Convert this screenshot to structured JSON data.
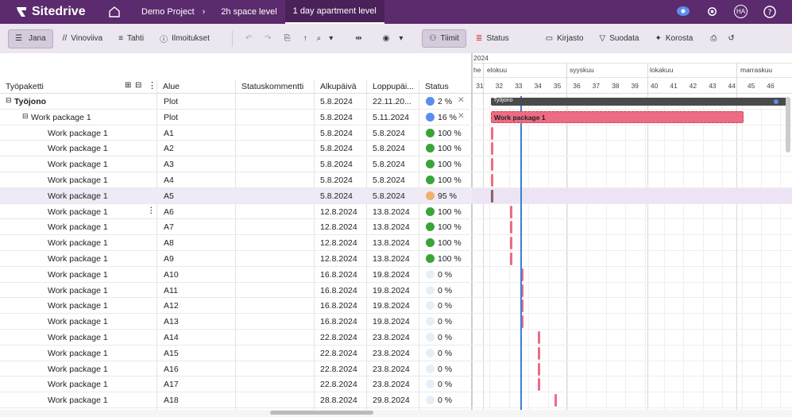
{
  "app": {
    "name": "Sitedrive"
  },
  "breadcrumbs": [
    "Demo Project",
    "2h space level",
    "1 day apartment level"
  ],
  "user": {
    "initials": "HA"
  },
  "toolbar": {
    "jana": "Jana",
    "vinoviiva": "Vinoviiva",
    "tahti": "Tahti",
    "ilmoitukset": "Ilmoitukset",
    "tiimit": "Tiimit",
    "status": "Status",
    "kirjasto": "Kirjasto",
    "suodata": "Suodata",
    "korosta": "Korosta"
  },
  "columns": [
    "Työpaketti",
    "Alue",
    "Statuskommentti",
    "Alkupäivä",
    "Loppupäi...",
    "Status"
  ],
  "rows": [
    {
      "name": "Työjono",
      "alue": "Plot",
      "start": "5.8.2024",
      "end": "22.11.20...",
      "pct": "2 %",
      "color": "#5b8def",
      "level": 0
    },
    {
      "name": "Work package 1",
      "alue": "Plot",
      "start": "5.8.2024",
      "end": "5.11.2024",
      "pct": "16 %",
      "color": "#5b8def",
      "level": 1
    },
    {
      "name": "Work package 1",
      "alue": "A1",
      "start": "5.8.2024",
      "end": "5.8.2024",
      "pct": "100 %",
      "color": "#3aa33a",
      "level": 2
    },
    {
      "name": "Work package 1",
      "alue": "A2",
      "start": "5.8.2024",
      "end": "5.8.2024",
      "pct": "100 %",
      "color": "#3aa33a",
      "level": 2
    },
    {
      "name": "Work package 1",
      "alue": "A3",
      "start": "5.8.2024",
      "end": "5.8.2024",
      "pct": "100 %",
      "color": "#3aa33a",
      "level": 2
    },
    {
      "name": "Work package 1",
      "alue": "A4",
      "start": "5.8.2024",
      "end": "5.8.2024",
      "pct": "100 %",
      "color": "#3aa33a",
      "level": 2
    },
    {
      "name": "Work package 1",
      "alue": "A5",
      "start": "5.8.2024",
      "end": "5.8.2024",
      "pct": "95 %",
      "color": "#f0b070",
      "level": 2
    },
    {
      "name": "Work package 1",
      "alue": "A6",
      "start": "12.8.2024",
      "end": "13.8.2024",
      "pct": "100 %",
      "color": "#3aa33a",
      "level": 2
    },
    {
      "name": "Work package 1",
      "alue": "A7",
      "start": "12.8.2024",
      "end": "13.8.2024",
      "pct": "100 %",
      "color": "#3aa33a",
      "level": 2
    },
    {
      "name": "Work package 1",
      "alue": "A8",
      "start": "12.8.2024",
      "end": "13.8.2024",
      "pct": "100 %",
      "color": "#3aa33a",
      "level": 2
    },
    {
      "name": "Work package 1",
      "alue": "A9",
      "start": "12.8.2024",
      "end": "13.8.2024",
      "pct": "100 %",
      "color": "#3aa33a",
      "level": 2
    },
    {
      "name": "Work package 1",
      "alue": "A10",
      "start": "16.8.2024",
      "end": "19.8.2024",
      "pct": "0 %",
      "color": "#e8eef8",
      "level": 2
    },
    {
      "name": "Work package 1",
      "alue": "A11",
      "start": "16.8.2024",
      "end": "19.8.2024",
      "pct": "0 %",
      "color": "#e8eef8",
      "level": 2
    },
    {
      "name": "Work package 1",
      "alue": "A12",
      "start": "16.8.2024",
      "end": "19.8.2024",
      "pct": "0 %",
      "color": "#e8eef8",
      "level": 2
    },
    {
      "name": "Work package 1",
      "alue": "A13",
      "start": "16.8.2024",
      "end": "19.8.2024",
      "pct": "0 %",
      "color": "#e8eef8",
      "level": 2
    },
    {
      "name": "Work package 1",
      "alue": "A14",
      "start": "22.8.2024",
      "end": "23.8.2024",
      "pct": "0 %",
      "color": "#e8eef8",
      "level": 2
    },
    {
      "name": "Work package 1",
      "alue": "A15",
      "start": "22.8.2024",
      "end": "23.8.2024",
      "pct": "0 %",
      "color": "#e8eef8",
      "level": 2
    },
    {
      "name": "Work package 1",
      "alue": "A16",
      "start": "22.8.2024",
      "end": "23.8.2024",
      "pct": "0 %",
      "color": "#e8eef8",
      "level": 2
    },
    {
      "name": "Work package 1",
      "alue": "A17",
      "start": "22.8.2024",
      "end": "23.8.2024",
      "pct": "0 %",
      "color": "#e8eef8",
      "level": 2
    },
    {
      "name": "Work package 1",
      "alue": "A18",
      "start": "28.8.2024",
      "end": "29.8.2024",
      "pct": "0 %",
      "color": "#e8eef8",
      "level": 2
    }
  ],
  "gantt": {
    "year": "2024",
    "months": [
      "he",
      "elokuu",
      "syyskuu",
      "lokakuu",
      "marraskuu"
    ],
    "weeks": [
      "31",
      "32",
      "33",
      "34",
      "35",
      "36",
      "37",
      "38",
      "39",
      "40",
      "41",
      "42",
      "43",
      "44",
      "45",
      "46"
    ],
    "summary_label": "Työjono",
    "wp_label": "Work package 1"
  }
}
